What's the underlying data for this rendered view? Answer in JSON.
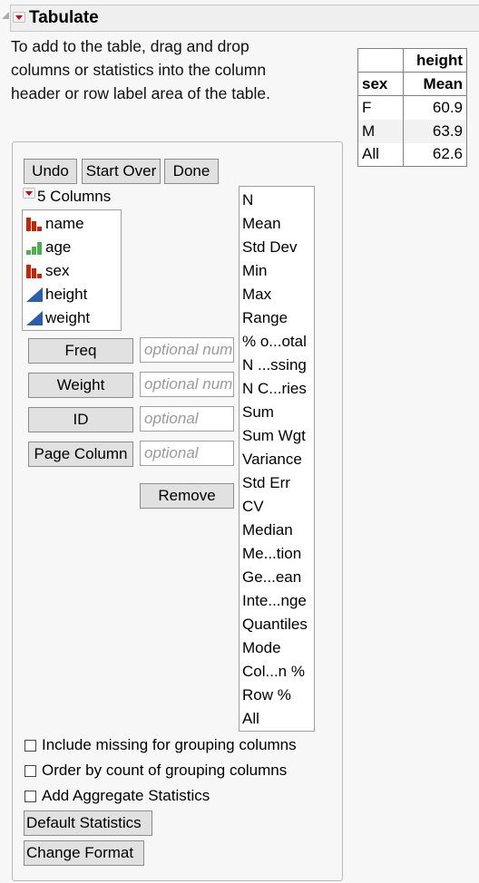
{
  "title": "Tabulate",
  "instructions": "To add to the table, drag and drop columns or statistics into the column header or row label area of the table.",
  "result_table": {
    "column_group": "height",
    "row_header": "sex",
    "statistic": "Mean",
    "rows": [
      {
        "label": "F",
        "value": "60.9"
      },
      {
        "label": "M",
        "value": "63.9"
      },
      {
        "label": "All",
        "value": "62.6"
      }
    ]
  },
  "toolbar": {
    "undo_label": "Undo",
    "start_over_label": "Start Over",
    "done_label": "Done"
  },
  "columns_header": "5 Columns",
  "columns": [
    {
      "name": "name",
      "type": "nominal"
    },
    {
      "name": "age",
      "type": "ordinal"
    },
    {
      "name": "sex",
      "type": "nominal"
    },
    {
      "name": "height",
      "type": "continuous"
    },
    {
      "name": "weight",
      "type": "continuous"
    }
  ],
  "roles": [
    {
      "label": "Freq",
      "placeholder": "optional numeric"
    },
    {
      "label": "Weight",
      "placeholder": "optional numeric"
    },
    {
      "label": "ID",
      "placeholder": "optional"
    },
    {
      "label": "Page Column",
      "placeholder": "optional"
    }
  ],
  "remove_label": "Remove",
  "statistics": [
    "N",
    "Mean",
    "Std Dev",
    "Min",
    "Max",
    "Range",
    "% o...otal",
    "N ...ssing",
    "N C...ries",
    "Sum",
    "Sum Wgt",
    "Variance",
    "Std Err",
    "CV",
    "Median",
    "Me...tion",
    "Ge...ean",
    "Inte...nge",
    "Quantiles",
    "Mode",
    "Col...n %",
    "Row %",
    "All"
  ],
  "options": [
    {
      "label": "Include missing for grouping columns",
      "checked": false
    },
    {
      "label": "Order by count of grouping columns",
      "checked": false
    },
    {
      "label": "Add Aggregate Statistics",
      "checked": false
    }
  ],
  "default_statistics_label": "Default Statistics",
  "change_format_label": "Change Format",
  "colors": {
    "nominal": "#cc2200",
    "ordinal": "#4caf50",
    "continuous": "#2a5db0",
    "menu_triangle": "#d0021b"
  }
}
